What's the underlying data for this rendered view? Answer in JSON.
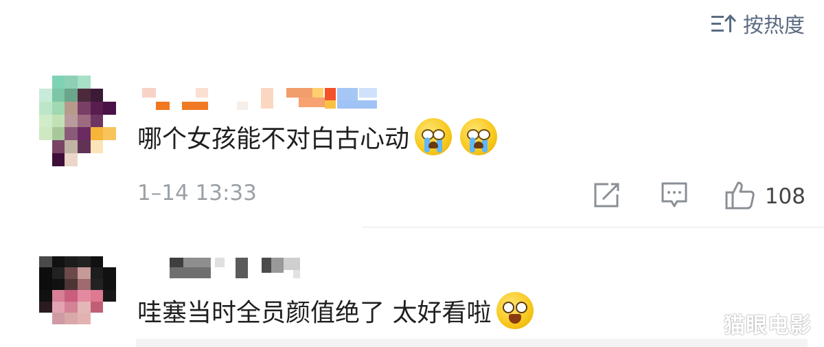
{
  "sort": {
    "label": "按热度",
    "icon": "sort-icon"
  },
  "comments": [
    {
      "text": "哪个女孩能不对白古心动",
      "emojis": [
        "crying-emoji",
        "crying-emoji"
      ],
      "time": "1–14 13:33",
      "like_count": "108"
    },
    {
      "text": "哇塞当时全员颜值绝了 太好看啦",
      "emojis": [
        "happy-emoji"
      ]
    }
  ],
  "watermark": "猫眼电影",
  "colors": {
    "sort": "#5b6b82",
    "time": "#9aa0a6",
    "text": "#1f1f1f"
  }
}
